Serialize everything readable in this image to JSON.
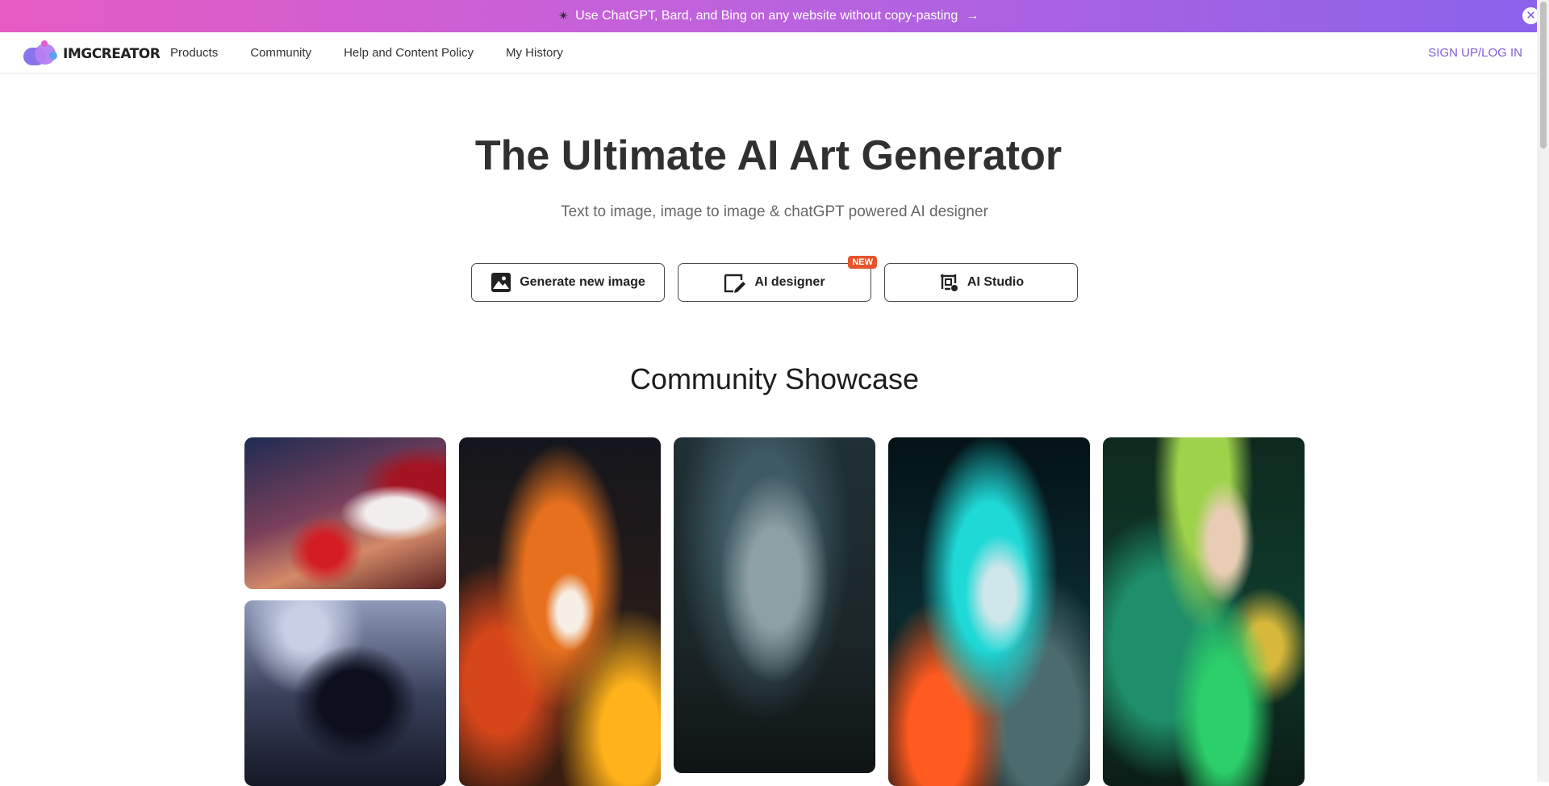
{
  "promo": {
    "text": "Use ChatGPT, Bard, and Bing on any website without copy-pasting",
    "arrow": "→",
    "close": "✕"
  },
  "nav": {
    "logo_text": "IMGCREATOR",
    "links": [
      "Products",
      "Community",
      "Help and Content Policy",
      "My History"
    ],
    "signin": "SIGN UP/LOG IN"
  },
  "hero": {
    "title": "The Ultimate AI Art Generator",
    "subtitle": "Text to image, image to image & chatGPT powered AI designer",
    "buttons": {
      "generate": "Generate new image",
      "designer": "AI designer",
      "designer_badge": "NEW",
      "studio": "AI Studio"
    }
  },
  "showcase": {
    "title": "Community Showcase"
  },
  "colors": {
    "accent": "#7b5ed8",
    "badge": "#e4552b"
  }
}
